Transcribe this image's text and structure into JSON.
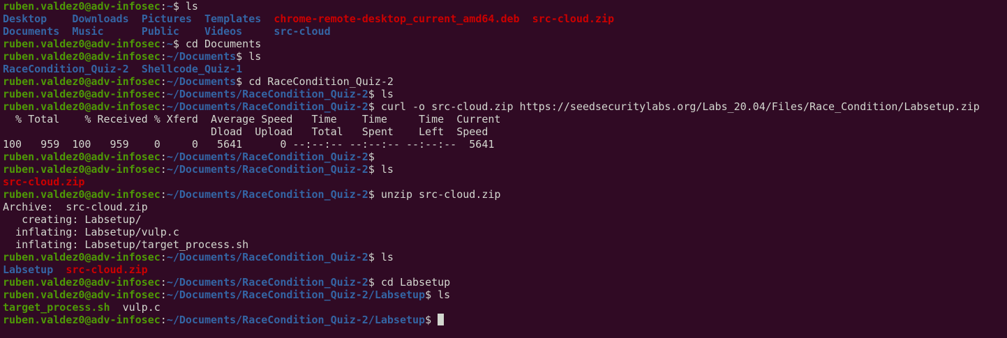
{
  "terminal": {
    "colors": {
      "background": "#300a24",
      "text": "#d3d7cf",
      "prompt_user": "#4e9a06",
      "prompt_path": "#3465a4",
      "directory": "#3465a4",
      "archive": "#cc0000",
      "executable": "#4e9a06"
    },
    "lines": [
      {
        "type": "prompt",
        "user": "ruben.valdez0@adv-infosec",
        "path": "~",
        "cmd": " ls"
      },
      {
        "type": "listing",
        "items": [
          {
            "text": "Desktop    ",
            "kind": "dir"
          },
          {
            "text": "Downloads  ",
            "kind": "dir"
          },
          {
            "text": "Pictures  ",
            "kind": "dir"
          },
          {
            "text": "Templates  ",
            "kind": "dir"
          },
          {
            "text": "chrome-remote-desktop_current_amd64.deb",
            "kind": "arch"
          },
          {
            "text": "  ",
            "kind": "plain"
          },
          {
            "text": "src-cloud.zip",
            "kind": "arch"
          }
        ]
      },
      {
        "type": "listing",
        "items": [
          {
            "text": "Documents  ",
            "kind": "dir"
          },
          {
            "text": "Music      ",
            "kind": "dir"
          },
          {
            "text": "Public    ",
            "kind": "dir"
          },
          {
            "text": "Videos     ",
            "kind": "dir"
          },
          {
            "text": "src-cloud",
            "kind": "dir"
          }
        ]
      },
      {
        "type": "prompt",
        "user": "ruben.valdez0@adv-infosec",
        "path": "~",
        "cmd": " cd Documents"
      },
      {
        "type": "prompt",
        "user": "ruben.valdez0@adv-infosec",
        "path": "~/Documents",
        "cmd": " ls"
      },
      {
        "type": "listing",
        "items": [
          {
            "text": "RaceCondition_Quiz-2",
            "kind": "dir"
          },
          {
            "text": "  ",
            "kind": "plain"
          },
          {
            "text": "Shellcode_Quiz-1",
            "kind": "dir"
          }
        ]
      },
      {
        "type": "prompt",
        "user": "ruben.valdez0@adv-infosec",
        "path": "~/Documents",
        "cmd": " cd RaceCondition_Quiz-2"
      },
      {
        "type": "prompt",
        "user": "ruben.valdez0@adv-infosec",
        "path": "~/Documents/RaceCondition_Quiz-2",
        "cmd": " ls"
      },
      {
        "type": "prompt",
        "user": "ruben.valdez0@adv-infosec",
        "path": "~/Documents/RaceCondition_Quiz-2",
        "cmd": " curl -o src-cloud.zip https://seedsecuritylabs.org/Labs_20.04/Files/Race_Condition/Labsetup.zip"
      },
      {
        "type": "text",
        "text": "  % Total    % Received % Xferd  Average Speed   Time    Time     Time  Current"
      },
      {
        "type": "text",
        "text": "                                 Dload  Upload   Total   Spent    Left  Speed"
      },
      {
        "type": "text",
        "text": "100   959  100   959    0     0   5641      0 --:--:-- --:--:-- --:--:--  5641"
      },
      {
        "type": "prompt",
        "user": "ruben.valdez0@adv-infosec",
        "path": "~/Documents/RaceCondition_Quiz-2",
        "cmd": ""
      },
      {
        "type": "prompt",
        "user": "ruben.valdez0@adv-infosec",
        "path": "~/Documents/RaceCondition_Quiz-2",
        "cmd": " ls"
      },
      {
        "type": "listing",
        "items": [
          {
            "text": "src-cloud.zip",
            "kind": "arch"
          }
        ]
      },
      {
        "type": "prompt",
        "user": "ruben.valdez0@adv-infosec",
        "path": "~/Documents/RaceCondition_Quiz-2",
        "cmd": " unzip src-cloud.zip"
      },
      {
        "type": "text",
        "text": "Archive:  src-cloud.zip"
      },
      {
        "type": "text",
        "text": "   creating: Labsetup/"
      },
      {
        "type": "text",
        "text": "  inflating: Labsetup/vulp.c"
      },
      {
        "type": "text",
        "text": "  inflating: Labsetup/target_process.sh"
      },
      {
        "type": "prompt",
        "user": "ruben.valdez0@adv-infosec",
        "path": "~/Documents/RaceCondition_Quiz-2",
        "cmd": " ls"
      },
      {
        "type": "listing",
        "items": [
          {
            "text": "Labsetup",
            "kind": "dir"
          },
          {
            "text": "  ",
            "kind": "plain"
          },
          {
            "text": "src-cloud.zip",
            "kind": "arch"
          }
        ]
      },
      {
        "type": "prompt",
        "user": "ruben.valdez0@adv-infosec",
        "path": "~/Documents/RaceCondition_Quiz-2",
        "cmd": " cd Labsetup"
      },
      {
        "type": "prompt",
        "user": "ruben.valdez0@adv-infosec",
        "path": "~/Documents/RaceCondition_Quiz-2/Labsetup",
        "cmd": " ls"
      },
      {
        "type": "listing",
        "items": [
          {
            "text": "target_process.sh",
            "kind": "exec"
          },
          {
            "text": "  vulp.c",
            "kind": "plain"
          }
        ]
      },
      {
        "type": "prompt",
        "user": "ruben.valdez0@adv-infosec",
        "path": "~/Documents/RaceCondition_Quiz-2/Labsetup",
        "cmd": " ",
        "cursor": true
      }
    ]
  }
}
